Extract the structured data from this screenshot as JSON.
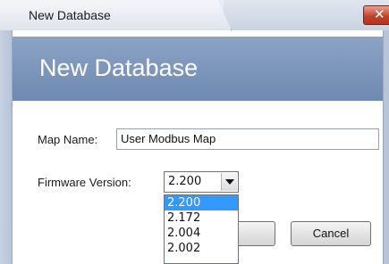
{
  "window": {
    "title": "New Database",
    "close_glyph": "✕"
  },
  "banner": {
    "title": "New Database"
  },
  "form": {
    "map_name_label": "Map Name:",
    "map_name_value": "User Modbus Map",
    "firmware_label": "Firmware Version:",
    "firmware_selected": "2.200"
  },
  "dropdown": {
    "options": [
      "2.200",
      "2.172",
      "2.004",
      "2.002"
    ],
    "highlighted": "2.200"
  },
  "buttons": {
    "ok_label": "",
    "cancel_label": "Cancel"
  },
  "colors": {
    "banner": "#7f97bd",
    "selection": "#3399ff",
    "close": "#c1432b"
  },
  "icons": {
    "close": "close-icon",
    "dropdown_arrow": "chevron-down-icon"
  }
}
